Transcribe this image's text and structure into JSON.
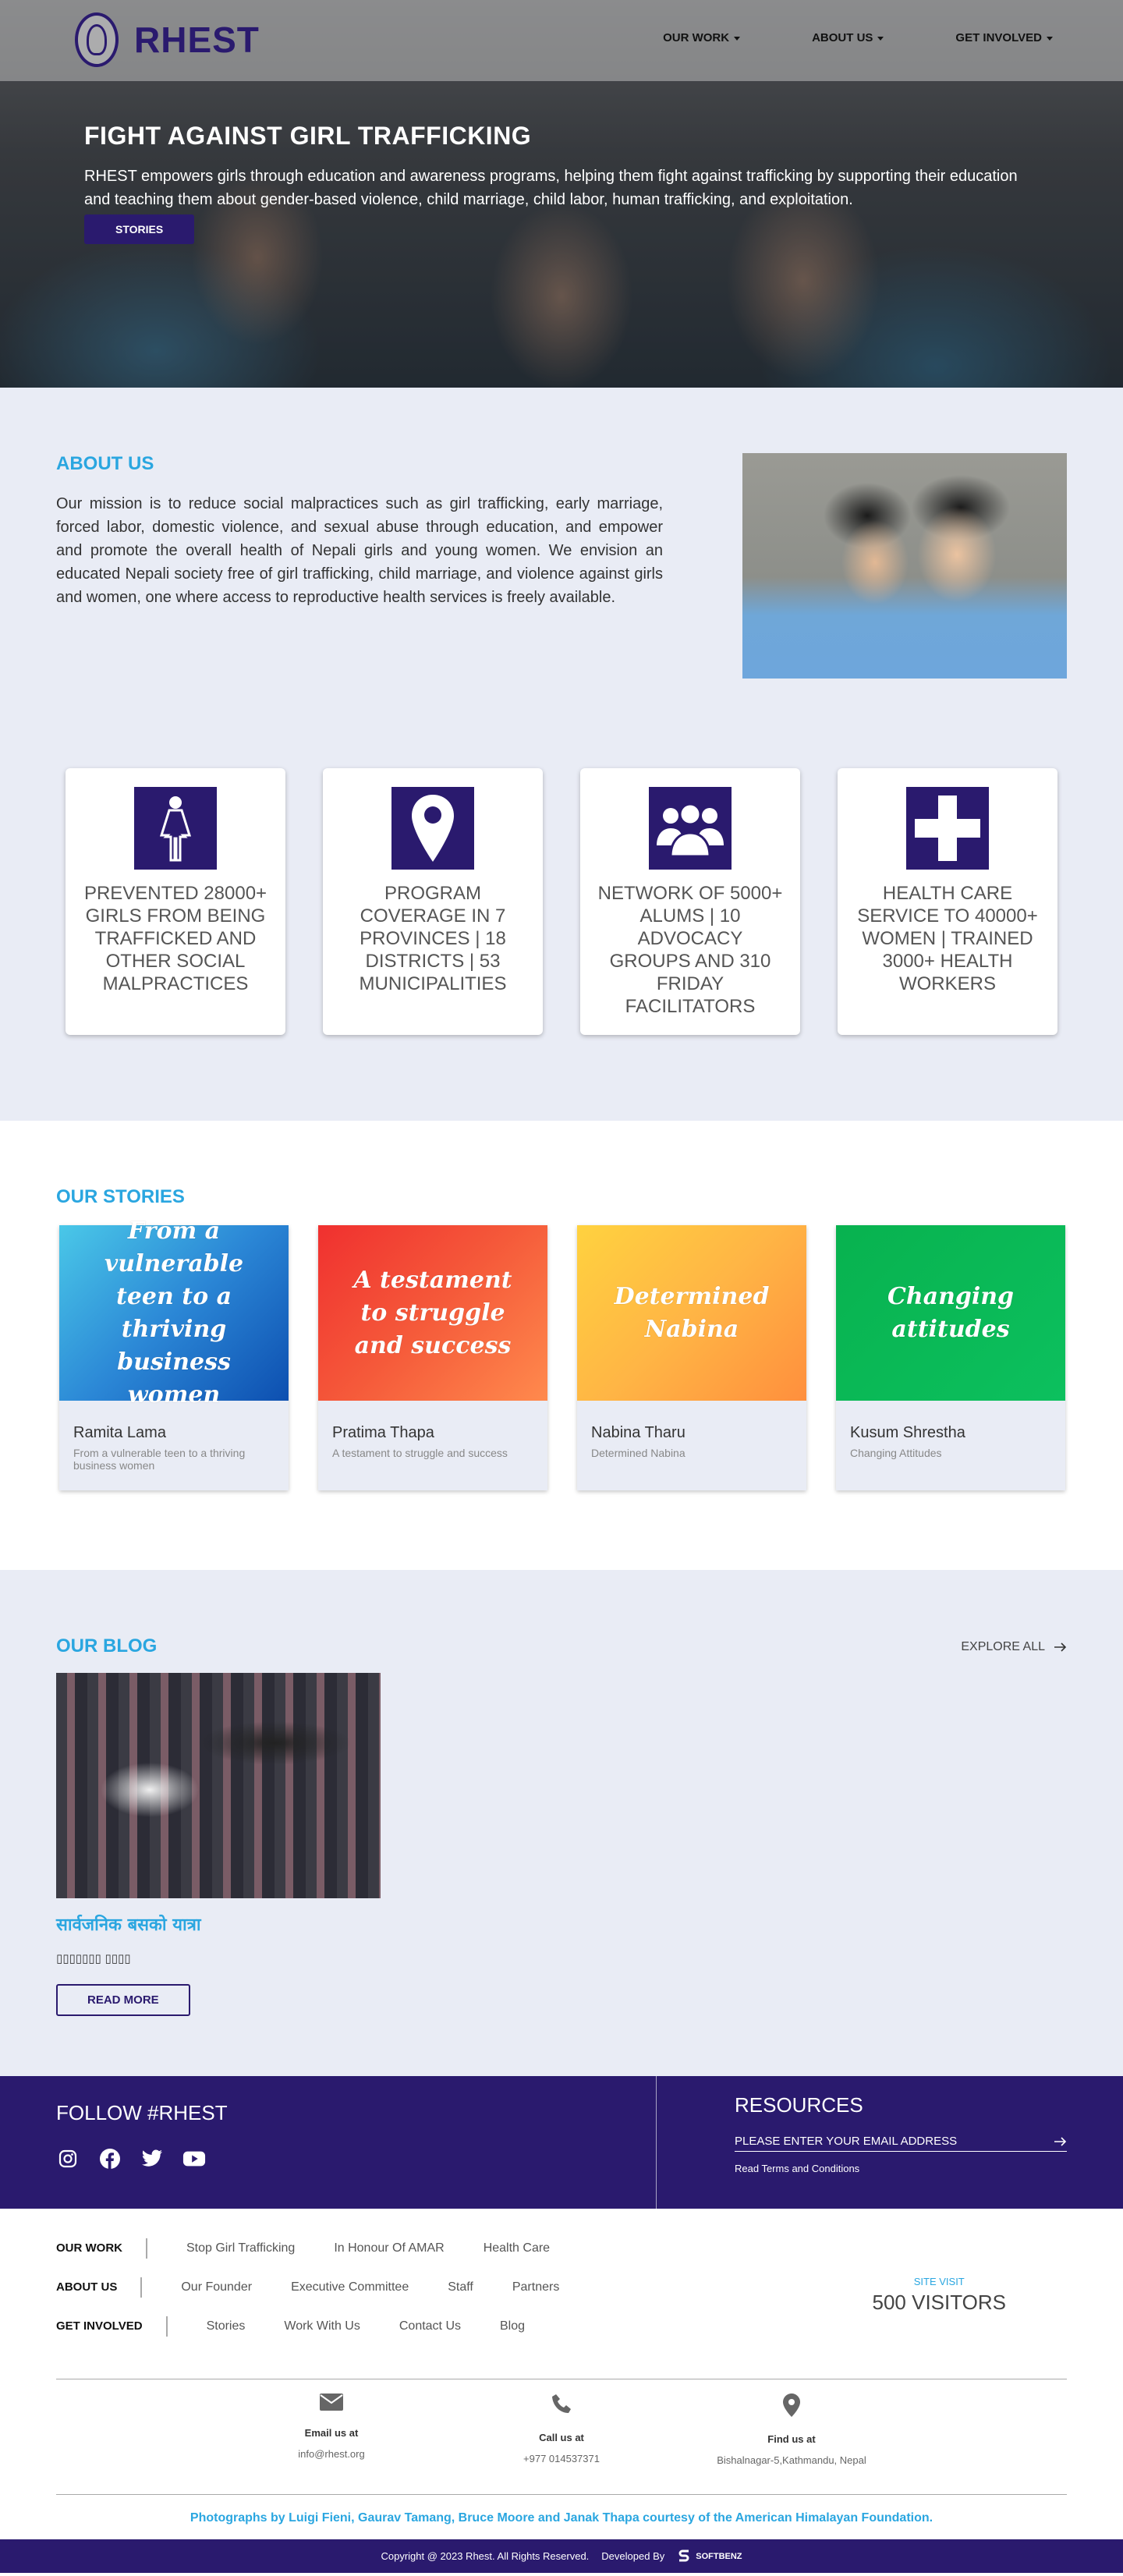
{
  "nav": {
    "logo_text": "RHEST",
    "items": [
      {
        "label": "OUR WORK"
      },
      {
        "label": "ABOUT US"
      },
      {
        "label": "GET INVOLVED"
      }
    ]
  },
  "hero": {
    "title": "FIGHT AGAINST GIRL TRAFFICKING",
    "text": "RHEST empowers girls through education and awareness programs, helping them fight against trafficking by supporting their education and teaching them about gender-based violence, child marriage, child labor, human trafficking, and exploitation.",
    "button": "STORIES"
  },
  "about": {
    "title": "ABOUT US",
    "text": "Our mission is to reduce social malpractices such as girl trafficking, early marriage, forced labor, domestic violence, and sexual abuse through education, and empower and promote the overall health of Nepali girls and young women. We envision an educated Nepali society free of girl trafficking, child marriage, and violence against girls and women, one where access to reproductive health services is freely available."
  },
  "stats": [
    {
      "icon": "female-figure-icon",
      "text": "PREVENTED 28000+ GIRLS FROM BEING TRAFFICKED AND OTHER SOCIAL MALPRACTICES"
    },
    {
      "icon": "map-pin-icon",
      "text": "PROGRAM COVERAGE IN 7 PROVINCES | 18 DISTRICTS | 53 MUNICIPALITIES"
    },
    {
      "icon": "group-icon",
      "text": "NETWORK OF 5000+ ALUMS | 10 ADVOCACY GROUPS AND 310 FRIDAY FACILITATORS"
    },
    {
      "icon": "medical-cross-icon",
      "text": "HEALTH CARE SERVICE TO 40000+ WOMEN | TRAINED 3000+ HEALTH WORKERS"
    }
  ],
  "stories": {
    "title": "OUR STORIES",
    "items": [
      {
        "cover": "From a vulnerable teen to a thriving business women",
        "name": "Ramita Lama",
        "sub": "From a vulnerable teen to a thriving business women",
        "gradient": "linear-gradient(135deg,#4ac8e8 0%,#2b87d6 50%,#0d4fb0 100%)"
      },
      {
        "cover": "A testament to struggle and success",
        "name": "Pratima Thapa",
        "sub": "A testament to struggle and success",
        "gradient": "linear-gradient(135deg,#f0302f 0%,#f55a3a 50%,#ff8a4d 100%)"
      },
      {
        "cover": "Determined Nabina",
        "name": "Nabina Tharu",
        "sub": "Determined Nabina",
        "gradient": "linear-gradient(135deg,#ffd23f 0%,#ffb545 50%,#ff8f3d 100%)"
      },
      {
        "cover": "Changing attitudes",
        "name": "Kusum Shrestha",
        "sub": "Changing Attitudes",
        "gradient": "linear-gradient(135deg,#08b24f 0%,#0cc05e 100%)"
      }
    ]
  },
  "blog": {
    "title": "OUR BLOG",
    "explore": "EXPLORE ALL",
    "post_title": "सार्वजनिक बसको यात्रा",
    "post_sub": "▯▯▯▯▯▯▯ ▯▯▯▯",
    "read_more": "READ MORE"
  },
  "follow": {
    "title": "FOLLOW #RHEST",
    "socials": [
      "instagram-icon",
      "facebook-icon",
      "twitter-icon",
      "youtube-icon"
    ]
  },
  "resources": {
    "title": "RESOURCES",
    "email_placeholder": "PLEASE ENTER YOUR EMAIL ADDRESS",
    "terms": "Read Terms and Conditions"
  },
  "footer": {
    "rows": [
      {
        "head": "OUR WORK",
        "links": [
          "Stop Girl Trafficking",
          "In Honour Of AMAR",
          "Health Care"
        ]
      },
      {
        "head": "ABOUT US",
        "links": [
          "Our Founder",
          "Executive Committee",
          "Staff",
          "Partners"
        ]
      },
      {
        "head": "GET INVOLVED",
        "links": [
          "Stories",
          "Work With Us",
          "Contact Us",
          "Blog"
        ]
      }
    ],
    "site_visit_label": "SITE VISIT",
    "site_visit_count": "500 VISITORS",
    "contacts": [
      {
        "icon": "envelope-icon",
        "label": "Email us at",
        "value": "info@rhest.org"
      },
      {
        "icon": "phone-icon",
        "label": "Call us at",
        "value": "+977 014537371"
      },
      {
        "icon": "location-pin-icon",
        "label": "Find us at",
        "value": "Bishalnagar-5,Kathmandu, Nepal"
      }
    ],
    "credit": "Photographs by Luigi Fieni, Gaurav Tamang, Bruce Moore and Janak Thapa courtesy of the American Himalayan Foundation."
  },
  "copyright": {
    "text": "Copyright @ 2023 Rhest. All Rights Reserved.",
    "developed_by": "Developed By",
    "developer": "SOFTBENZ"
  },
  "colors": {
    "brand_purple": "#2a1a6e",
    "accent_blue": "#2aa6e0",
    "section_bg": "#e9ecf5"
  }
}
